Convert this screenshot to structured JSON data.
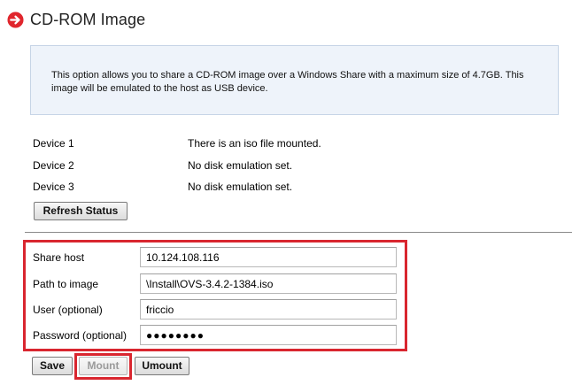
{
  "header": {
    "title": "CD-ROM Image"
  },
  "info": {
    "text": "This option allows you to share a CD-ROM image over a Windows Share with a maximum size of 4.7GB. This image will be emulated to the host as USB device."
  },
  "devices": [
    {
      "label": "Device 1",
      "status": "There is an iso file mounted."
    },
    {
      "label": "Device 2",
      "status": "No disk emulation set."
    },
    {
      "label": "Device 3",
      "status": "No disk emulation set."
    }
  ],
  "buttons": {
    "refresh": "Refresh Status",
    "save": "Save",
    "mount": "Mount",
    "umount": "Umount"
  },
  "form": {
    "share_host_label": "Share host",
    "share_host_value": "10.124.108.116",
    "path_label": "Path to image",
    "path_value": "\\Install\\OVS-3.4.2-1384.iso",
    "user_label": "User (optional)",
    "user_value": "friccio",
    "password_label": "Password (optional)",
    "password_value": "●●●●●●●●"
  },
  "colors": {
    "highlight": "#d9262f",
    "header_icon": "#e0262d",
    "info_bg": "#eef3fa"
  },
  "icons": {
    "header": "arrow-right-circle-icon"
  }
}
